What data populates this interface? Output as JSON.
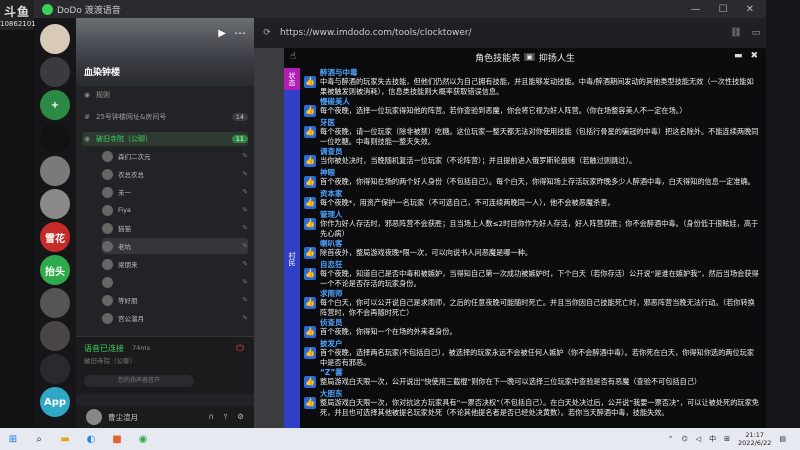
{
  "watermark": {
    "brand": "斗鱼",
    "room": "10862101"
  },
  "window": {
    "title": "DoDo 渡渡语音",
    "controls": [
      "—",
      "☐",
      "✕"
    ]
  },
  "servers": [
    {
      "label": "",
      "color": "#d9c9b8"
    },
    {
      "label": "",
      "color": "#3a3a3f"
    },
    {
      "label": "+",
      "color": "#2d8a45"
    },
    {
      "label": "",
      "color": "#111"
    },
    {
      "label": "",
      "color": "#7a7a7a"
    },
    {
      "label": "",
      "color": "#8c8a88"
    },
    {
      "label": "雪花",
      "color": "#c62b2b"
    },
    {
      "label": "抬头",
      "color": "#2faa4a"
    },
    {
      "label": "",
      "color": "#555"
    },
    {
      "label": "",
      "color": "#4a4545"
    },
    {
      "label": "",
      "color": "#2a2a2e"
    },
    {
      "label": "App",
      "color": "#2fa8c7"
    }
  ],
  "channel_panel": {
    "server_name": "血染钟楼",
    "rows": [
      {
        "icon": "◉",
        "label": "规则",
        "count": ""
      },
      {
        "icon": "#",
        "label": "25号钟楼网址&房间号",
        "count": "14"
      },
      {
        "icon": "◉",
        "label": "破旧寺院（公聊）",
        "count": "11"
      }
    ],
    "users": [
      "森们二次元",
      "衣总衣总",
      "未一",
      "Fiya",
      "猫猫",
      "老坑",
      "梁朋来",
      "",
      "等好朋",
      "宫公溜月"
    ],
    "voice": {
      "status": "语音已连接",
      "latency": "74ms",
      "sub": "破旧寺院（公聊）",
      "bar": "您的扬声器音开"
    },
    "me": {
      "name": "曹尘渲月"
    }
  },
  "browser": {
    "url": "https://www.imdodo.com/tools/clocktower/"
  },
  "panel": {
    "title": "角色技能表",
    "subtitle": "抑扬人生",
    "tab_a": "状态",
    "tab_b": "村民",
    "roles": [
      {
        "name": "醉酒与中毒",
        "desc": "中毒与醉酒的玩家失去技能，但他们仍然以为自己拥有技能，并且能够发动技能。中毒/醉酒期间发动的其他类型技能无效（一次性技能如果被触发则被消耗），信息类技能则大概率获取错误信息。"
      },
      {
        "name": "慢碰美人",
        "desc": "每个夜晚，选择一位玩家得知他的阵营。若你查验到恶魔，你会将它视为好人阵营。（你在场整容美人不一定在场。）"
      },
      {
        "name": "牙医",
        "desc": "每个夜晚，请一位玩家（除非被禁）吃糖。这位玩家一整天都无法对你使用技能（包括行骨星的骗冠的中毒）把这名除外。不能连续两晚同一位吃糖。中毒则技能一整天失效。"
      },
      {
        "name": "调查员",
        "desc": "当你被处决时，当晚随机复活一位玩家（不论阵营）；并且提前进入俄罗斯轮盘赌（若触过则跳过）。"
      },
      {
        "name": "神眼",
        "desc": "首个夜晚，你得知在场的两个好人身份（不包括自己）。每个白天，你得知场上存活玩家昨晚多少人醉酒中毒，白天得知的信息一定准确。"
      },
      {
        "name": "资本家",
        "desc": "每个夜晚*，用资产保护一名玩家（不可选自己，不可连续两晚同一人），他不会被恶魔杀害。"
      },
      {
        "name": "管理人",
        "desc": "你作为好人存活时，邪恶阵营不会获胜；且当场上人数≤2时目你作为好人存活，好人阵营获胜；你不会醉酒中毒。（身份低于很眩娃，高于先心病）"
      },
      {
        "name": "喇叭客",
        "desc": "除首夜外，整局游戏夜晚*限一次，可以向说书人问恶魔是哪一种。"
      },
      {
        "name": "自恋狂",
        "desc": "每个夜晚，知道自己是否中毒和被嫉妒，当得知自己第一次成功被嫉妒时，下个白天（若你存活）公开说“是谁在嫉妒我”，然后当场会获得一个不论是否存活的玩家身份。"
      },
      {
        "name": "求雨师",
        "desc": "每个白天，你可以公开说自己是求雨师，之后的任意夜晚可能随时死亡。并且当你因自己技能死亡时，邪恶阵营当晚无法行动。（若你转换阵营时，你不会再随时死亡）"
      },
      {
        "name": "侦查员",
        "desc": "首个夜晚，你得知一个在场的外来者身份。"
      },
      {
        "name": "披发户",
        "desc": "首个夜晚，选择两名玩家(不包括自己），被选择的玩家永远不会被任何人嫉妒（你不会醉酒中毒）。若你死在白天，你得知你选的两位玩家中是否有邪恶。"
      },
      {
        "name": "“Z”雾",
        "desc": "整局游戏白天限一次，公开说出“快使用三截棍”则你在下一晚可以选择三位玩家中查验是否有恶魔（查验不可包括自己）"
      },
      {
        "name": "大胆东",
        "desc": "整局游戏白天限一次，你对抗这方玩家具有“一票否决权”（不包括自己）。在白天处决过后，公开说“我要一票否决”，可以让被处死的玩家免死，并且也可选择其他被提名玩家处死（不论其他提名者是否已经处决黄数）。若你当天醉酒中毒，技能失效。"
      }
    ]
  },
  "taskbar": {
    "time": "21:17",
    "date": "2022/6/22",
    "ime": "中"
  }
}
